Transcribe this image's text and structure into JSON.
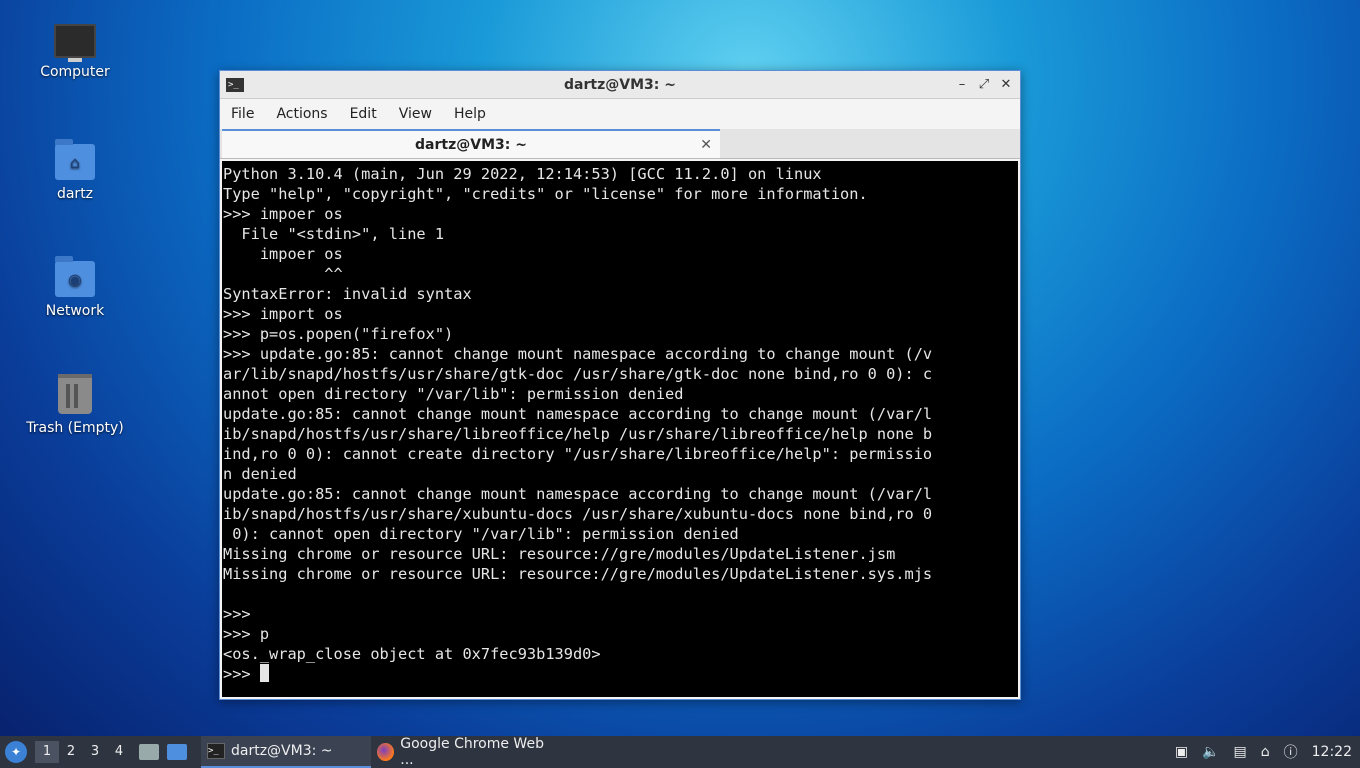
{
  "desktop": {
    "icons": [
      {
        "label": "Computer"
      },
      {
        "label": "dartz"
      },
      {
        "label": "Network"
      },
      {
        "label": "Trash (Empty)"
      }
    ]
  },
  "window": {
    "title": "dartz@VM3: ~",
    "controls": {
      "minimize": "–",
      "maximize": "⤢",
      "close": "✕"
    },
    "menu": [
      "File",
      "Actions",
      "Edit",
      "View",
      "Help"
    ],
    "tab": {
      "label": "dartz@VM3: ~",
      "close": "✕"
    }
  },
  "terminal": {
    "lines": [
      "Python 3.10.4 (main, Jun 29 2022, 12:14:53) [GCC 11.2.0] on linux",
      "Type \"help\", \"copyright\", \"credits\" or \"license\" for more information.",
      ">>> impoer os",
      "  File \"<stdin>\", line 1",
      "    impoer os",
      "           ^^",
      "SyntaxError: invalid syntax",
      ">>> import os",
      ">>> p=os.popen(\"firefox\")",
      ">>> update.go:85: cannot change mount namespace according to change mount (/v",
      "ar/lib/snapd/hostfs/usr/share/gtk-doc /usr/share/gtk-doc none bind,ro 0 0): c",
      "annot open directory \"/var/lib\": permission denied",
      "update.go:85: cannot change mount namespace according to change mount (/var/l",
      "ib/snapd/hostfs/usr/share/libreoffice/help /usr/share/libreoffice/help none b",
      "ind,ro 0 0): cannot create directory \"/usr/share/libreoffice/help\": permissio",
      "n denied",
      "update.go:85: cannot change mount namespace according to change mount (/var/l",
      "ib/snapd/hostfs/usr/share/xubuntu-docs /usr/share/xubuntu-docs none bind,ro 0",
      " 0): cannot open directory \"/var/lib\": permission denied",
      "Missing chrome or resource URL: resource://gre/modules/UpdateListener.jsm",
      "Missing chrome or resource URL: resource://gre/modules/UpdateListener.sys.mjs",
      "",
      ">>> ",
      ">>> p",
      "<os._wrap_close object at 0x7fec93b139d0>"
    ],
    "prompt": ">>> "
  },
  "taskbar": {
    "workspaces": [
      "1",
      "2",
      "3",
      "4"
    ],
    "active_workspace": "1",
    "tasks": [
      {
        "label": "dartz@VM3: ~",
        "icon": "terminal-icon"
      },
      {
        "label": "Google Chrome Web ...",
        "icon": "firefox-icon"
      }
    ],
    "clock": "12:22"
  }
}
